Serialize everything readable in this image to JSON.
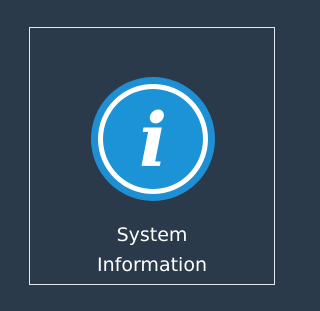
{
  "tile": {
    "label_line1": "System",
    "label_line2": "Information"
  },
  "icon": {
    "name": "info-icon",
    "glyph": "i",
    "colors": {
      "outer_ring": "#1f8fd4",
      "inner_ring": "#ffffff",
      "fill": "#1c93d6",
      "glyph": "#ffffff"
    }
  },
  "colors": {
    "background": "#2b3a4b",
    "tile_border": "#e6e9ec",
    "label": "#ffffff"
  }
}
